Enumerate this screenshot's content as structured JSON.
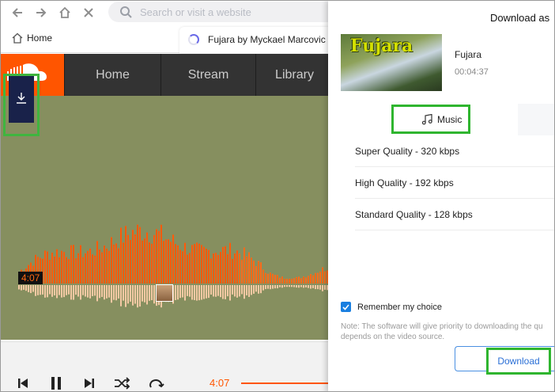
{
  "browser": {
    "search_placeholder": "Search or visit a website"
  },
  "tabs": {
    "home_label": "Home",
    "active_title": "Fujara by Myckael Marcovic"
  },
  "soundcloud": {
    "nav": [
      "Home",
      "Stream",
      "Library"
    ],
    "waveform_time": "4:07",
    "player_time": "4:07"
  },
  "download_panel": {
    "title": "Download as",
    "thumbnail_text": "Fujara",
    "media_title": "Fujara",
    "media_duration": "00:04:37",
    "tab_music": "Music",
    "qualities": [
      "Super Quality - 320 kbps",
      "High Quality - 192 kbps",
      "Standard Quality - 128 kbps"
    ],
    "remember_label": "Remember my choice",
    "remember_checked": true,
    "note_line1": "Note: The software will give priority to downloading the qu",
    "note_line2": "depends on the video source.",
    "download_label": "Download"
  },
  "colors": {
    "soundcloud_orange": "#ff5500",
    "highlight_green": "#2fb52f",
    "accent_blue": "#1a7fe0",
    "wave_bg": "#868f5f"
  }
}
